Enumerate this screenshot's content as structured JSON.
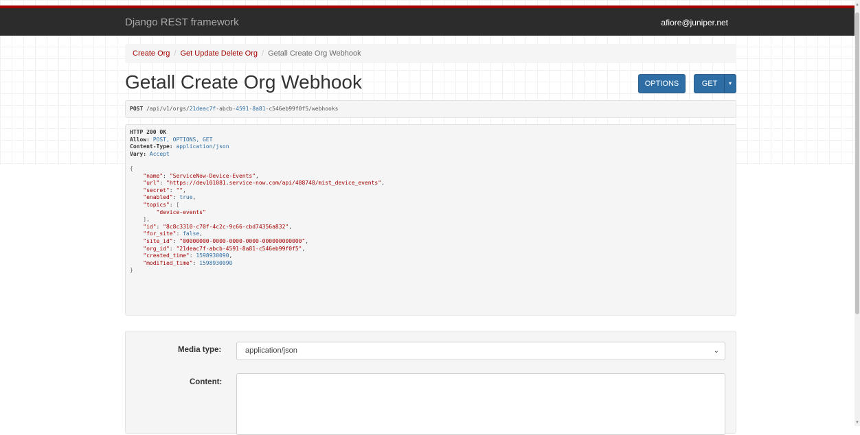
{
  "navbar": {
    "brand": "Django REST framework",
    "user": "afiore@juniper.net"
  },
  "breadcrumb": {
    "items": [
      "Create Org",
      "Get Update Delete Org"
    ],
    "active": "Getall Create Org Webhook",
    "separator": "/"
  },
  "page_title": "Getall Create Org Webhook",
  "buttons": {
    "options": "OPTIONS",
    "get": "GET",
    "get_caret": "▾"
  },
  "request": {
    "method": "POST",
    "path_prefix": "/api/v1/orgs/",
    "uid_part1": "21deac7f",
    "uid_part2": "-abcb-",
    "uid_part3": "4591",
    "uid_part4": "-",
    "uid_part5": "8a81",
    "uid_part6": "-c546eb99f0f5",
    "path_suffix": "/webhooks"
  },
  "response": {
    "status": "HTTP 200 OK",
    "headers": [
      {
        "name": "Allow:",
        "value": "POST, OPTIONS, GET"
      },
      {
        "name": "Content-Type:",
        "value": "application/json"
      },
      {
        "name": "Vary:",
        "value": "Accept"
      }
    ],
    "open_brace": "{",
    "close_brace": "}",
    "body": {
      "name_key": "\"name\"",
      "name_val": "\"ServiceNow-Device-Events\"",
      "url_key": "\"url\"",
      "url_val": "\"https://dev101081.service-now.com/api/488748/mist_device_events\"",
      "secret_key": "\"secret\"",
      "secret_val": "\"\"",
      "enabled_key": "\"enabled\"",
      "enabled_val": "true",
      "topics_key": "\"topics\"",
      "topics_open": "[",
      "topics_item": "\"device-events\"",
      "topics_close": "]",
      "id_key": "\"id\"",
      "id_val": "\"8c8c3310-c70f-4c2c-9c66-cbd74356a832\"",
      "for_site_key": "\"for_site\"",
      "for_site_val": "false",
      "site_id_key": "\"site_id\"",
      "site_id_val": "\"00000000-0000-0000-0000-000000000000\"",
      "org_id_key": "\"org_id\"",
      "org_id_val": "\"21deac7f-abcb-4591-8a81-c546eb99f0f5\"",
      "created_key": "\"created_time\"",
      "created_val": "1598930090",
      "modified_key": "\"modified_time\"",
      "modified_val": "1598930090"
    }
  },
  "form": {
    "media_type_label": "Media type:",
    "media_type_value": "application/json",
    "content_label": "Content:",
    "content_value": ""
  },
  "colors": {
    "navbar_bg": "#2c2c2c",
    "navbar_accent": "#a30000",
    "link": "#a30000",
    "button": "#2f6ea5"
  }
}
